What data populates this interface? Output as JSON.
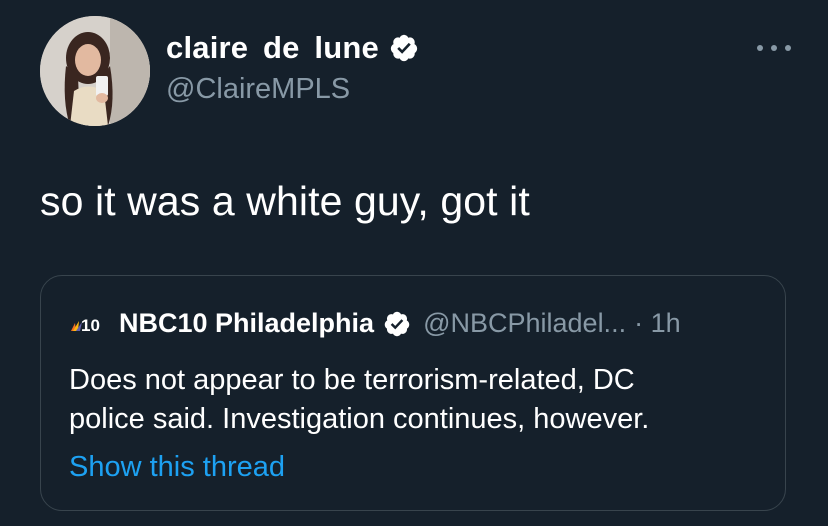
{
  "tweet": {
    "author_name": "claire  de  lune",
    "author_handle": "@ClaireMPLS",
    "text": "so it was a white guy, got it",
    "more_icon": "more-horizontal-icon"
  },
  "quoted_tweet": {
    "logo_text": "10",
    "author_name": "NBC10 Philadelphia",
    "author_handle": "@NBCPhiladel...",
    "time": "· 1h",
    "body_lines": [
      "Does not appear to be terrorism-related, DC",
      "police said. Investigation continues, however."
    ],
    "show_thread_label": "Show this thread"
  },
  "colors": {
    "background": "#15202b",
    "secondary_text": "#8899a6",
    "link": "#1da1f2",
    "border": "#38444d"
  }
}
